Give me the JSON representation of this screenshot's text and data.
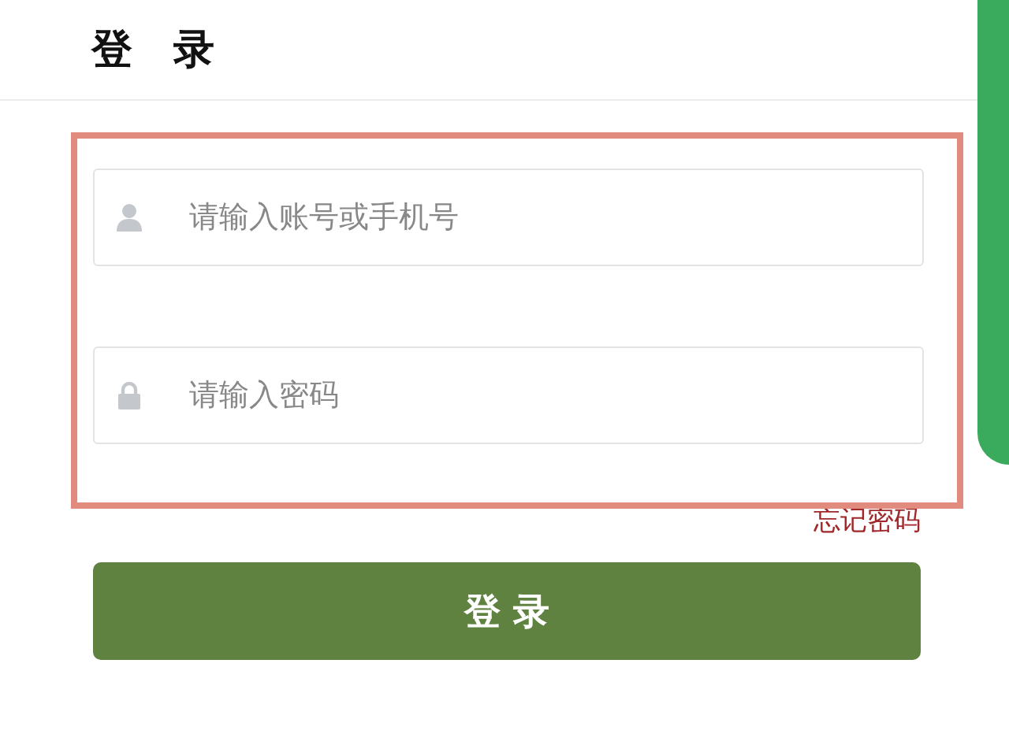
{
  "header": {
    "title": "登　录"
  },
  "fields": [
    {
      "kind": "user",
      "placeholder": "请输入账号或手机号"
    },
    {
      "kind": "password",
      "placeholder": "请输入密码"
    }
  ],
  "forgot_link": "忘记密码",
  "login_button": "登 录"
}
